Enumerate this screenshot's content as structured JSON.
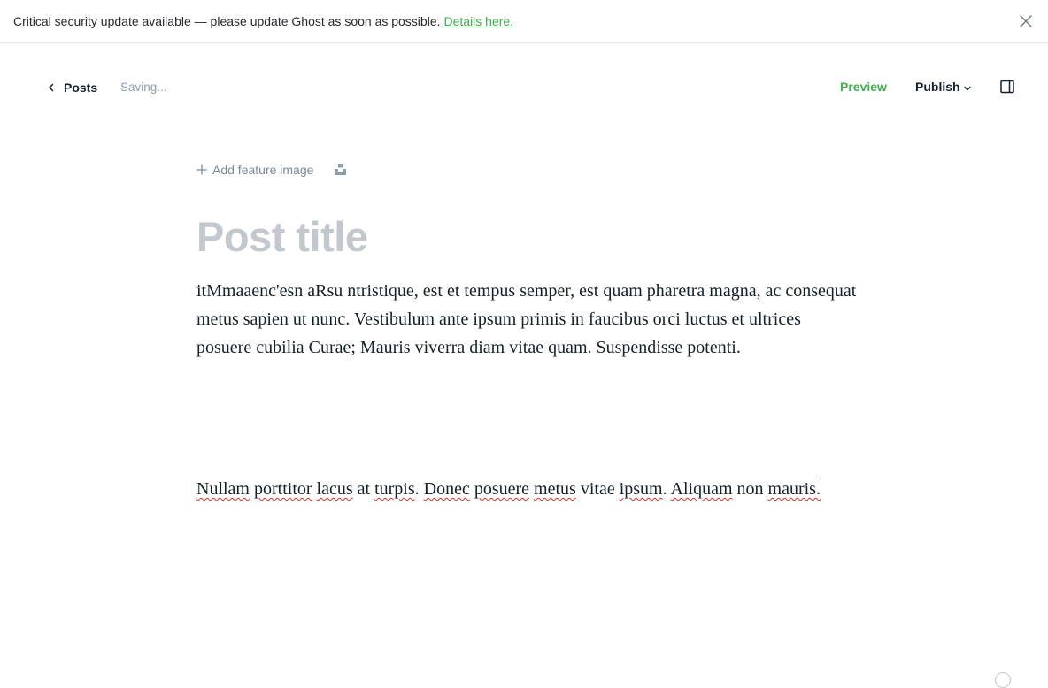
{
  "banner": {
    "message": "Critical security update available — please update Ghost as soon as possible.",
    "link_label": "Details here.",
    "close_icon": "close-icon"
  },
  "toolbar": {
    "back_label": "Posts",
    "status": "Saving...",
    "preview_label": "Preview",
    "publish_label": "Publish",
    "accent_color": "#3eb04d"
  },
  "editor": {
    "feature_image_label": "Add feature image",
    "title_placeholder": "Post title",
    "paragraphs": [
      {
        "text": "itMmaaenc'esn aRsu ntristique, est et tempus semper, est quam pharetra magna, ac consequat metus sapien ut nunc. Vestibulum ante ipsum primis in faucibus orci luctus et ultrices posuere cubilia Curae; Mauris viverra diam vitae quam. Suspendisse potenti."
      },
      {
        "words": [
          {
            "t": "Nullam",
            "spell": true
          },
          {
            "t": " ",
            "spell": false
          },
          {
            "t": "porttitor",
            "spell": true
          },
          {
            "t": " ",
            "spell": false
          },
          {
            "t": "lacus",
            "spell": true
          },
          {
            "t": " at ",
            "spell": false
          },
          {
            "t": "turpis",
            "spell": true
          },
          {
            "t": ". ",
            "spell": false
          },
          {
            "t": "Donec",
            "spell": true
          },
          {
            "t": " ",
            "spell": false
          },
          {
            "t": "posuere",
            "spell": true
          },
          {
            "t": " ",
            "spell": false
          },
          {
            "t": "metus",
            "spell": true
          },
          {
            "t": " vitae ",
            "spell": false
          },
          {
            "t": "ipsum",
            "spell": true
          },
          {
            "t": ". ",
            "spell": false
          },
          {
            "t": "Aliquam",
            "spell": true
          },
          {
            "t": " non ",
            "spell": false
          },
          {
            "t": "mauris.",
            "spell": true
          }
        ]
      }
    ]
  }
}
